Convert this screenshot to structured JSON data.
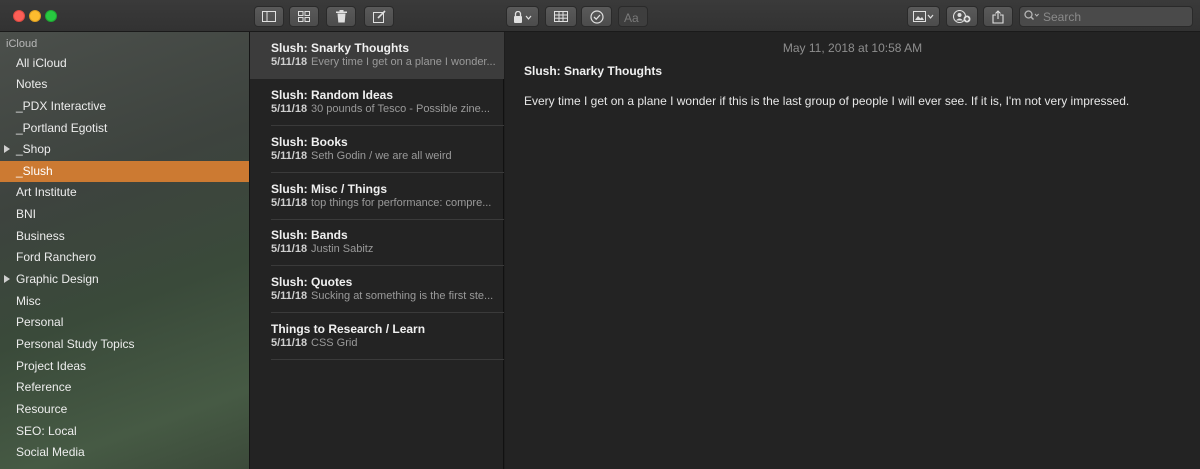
{
  "toolbar": {
    "search_placeholder": "Search",
    "icons": [
      "sidebar-icon",
      "grid-icon",
      "trash-icon",
      "compose-icon",
      "lock-icon",
      "table-icon",
      "checklist-icon",
      "font-icon",
      "photos-icon",
      "add-people-icon",
      "share-icon"
    ]
  },
  "sidebar": {
    "section": "iCloud",
    "items": [
      {
        "label": "All iCloud"
      },
      {
        "label": "Notes"
      },
      {
        "label": "_PDX Interactive"
      },
      {
        "label": "_Portland Egotist"
      },
      {
        "label": "_Shop"
      },
      {
        "label": "_Slush"
      },
      {
        "label": "Art Institute"
      },
      {
        "label": "BNI"
      },
      {
        "label": "Business"
      },
      {
        "label": "Ford Ranchero"
      },
      {
        "label": "Graphic Design"
      },
      {
        "label": "Misc"
      },
      {
        "label": "Personal"
      },
      {
        "label": "Personal Study Topics"
      },
      {
        "label": "Project Ideas"
      },
      {
        "label": "Reference"
      },
      {
        "label": "Resource"
      },
      {
        "label": "SEO: Local"
      },
      {
        "label": "Social Media"
      }
    ],
    "selected": "_Slush",
    "accent_color": "#cc7a32"
  },
  "notes": [
    {
      "title": "Slush: Snarky Thoughts",
      "date": "5/11/18",
      "snippet": "Every time I get on a plane I wonder..."
    },
    {
      "title": "Slush: Random Ideas",
      "date": "5/11/18",
      "snippet": "30 pounds of Tesco - Possible zine..."
    },
    {
      "title": "Slush: Books",
      "date": "5/11/18",
      "snippet": "Seth Godin / we are all weird"
    },
    {
      "title": "Slush: Misc / Things",
      "date": "5/11/18",
      "snippet": "top things for performance: compre..."
    },
    {
      "title": "Slush: Bands",
      "date": "5/11/18",
      "snippet": "Justin Sabitz"
    },
    {
      "title": "Slush: Quotes",
      "date": "5/11/18",
      "snippet": "Sucking at something is the first ste..."
    },
    {
      "title": "Things to Research / Learn",
      "date": "5/11/18",
      "snippet": "CSS Grid"
    }
  ],
  "editor": {
    "timestamp": "May 11, 2018 at 10:58 AM",
    "title": "Slush: Snarky Thoughts",
    "body": "Every time I get on a plane I wonder if this is the last group of people I will ever see. If it is, I'm not very impressed."
  }
}
